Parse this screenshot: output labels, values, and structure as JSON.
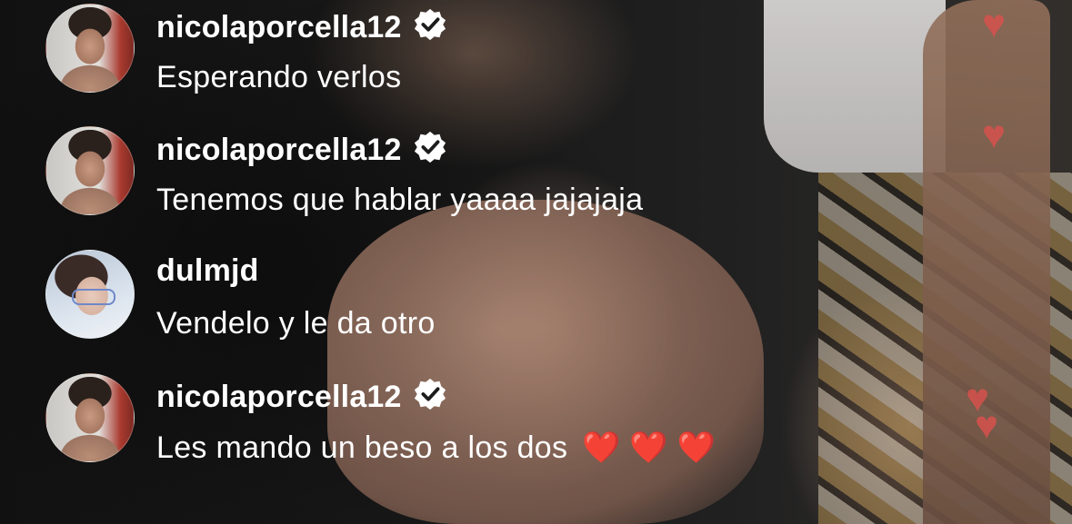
{
  "comments": [
    {
      "username": "nicolaporcella12",
      "verified": true,
      "text": "Esperando verlos",
      "avatar": "nicolaporcella12-avatar"
    },
    {
      "username": "nicolaporcella12",
      "verified": true,
      "text": "Tenemos que hablar yaaaa jajajaja",
      "avatar": "nicolaporcella12-avatar"
    },
    {
      "username": "dulmjd",
      "verified": false,
      "text": "Vendelo y le da otro",
      "avatar": "dulmjd-avatar"
    },
    {
      "username": "nicolaporcella12",
      "verified": true,
      "text": "Les mando un beso a los dos",
      "hearts": "❤️ ❤️ ❤️",
      "avatar": "nicolaporcella12-avatar"
    }
  ],
  "floating_reactions": [
    "heart-icon",
    "heart-icon",
    "heart-icon",
    "heart-icon"
  ],
  "colors": {
    "verified_badge": "#ffffff",
    "heart": "#e8423d",
    "text": "#ffffff"
  }
}
